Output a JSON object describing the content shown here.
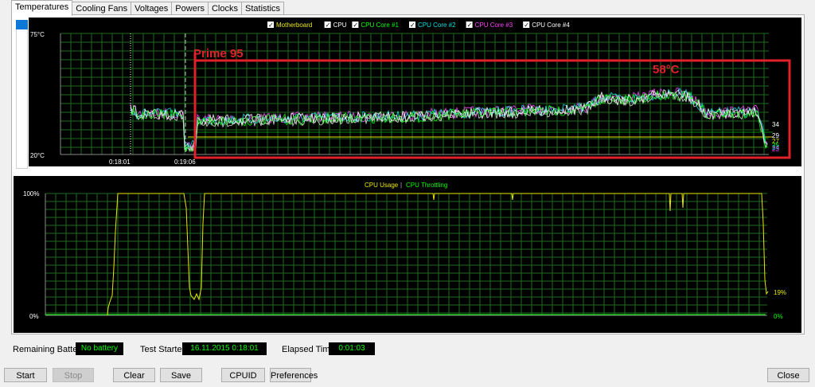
{
  "tabs": [
    {
      "label": "Temperatures",
      "active": true
    },
    {
      "label": "Cooling Fans"
    },
    {
      "label": "Voltages"
    },
    {
      "label": "Powers"
    },
    {
      "label": "Clocks"
    },
    {
      "label": "Statistics"
    }
  ],
  "temperature_chart": {
    "legend": [
      {
        "label": "Motherboard",
        "color": "#e8e800",
        "checked": true
      },
      {
        "label": "CPU",
        "color": "#ffffff",
        "checked": true
      },
      {
        "label": "CPU Core #1",
        "color": "#00ff00",
        "checked": true
      },
      {
        "label": "CPU Core #2",
        "color": "#00e0e0",
        "checked": true
      },
      {
        "label": "CPU Core #3",
        "color": "#ff40ff",
        "checked": true
      },
      {
        "label": "CPU Core #4",
        "color": "#ffffff",
        "checked": true
      }
    ],
    "y_top_label": "75°C",
    "y_bottom_label": "20°C",
    "time_labels": [
      "0:18:01",
      "0:19:06"
    ],
    "annotation_label": "Prime 95",
    "annotation_peak": "58°C",
    "annotation_color": "#e0202a",
    "end_values": [
      {
        "text": "34",
        "color": "#ffffff"
      },
      {
        "text": "29",
        "color": "#ffffff"
      },
      {
        "text": "27",
        "color": "#e8e800"
      },
      {
        "text": "25",
        "color": "#00ff00"
      },
      {
        "text": "24",
        "color": "#00e0e0"
      },
      {
        "text": "23",
        "color": "#ff40ff"
      }
    ]
  },
  "usage_chart": {
    "legend_usage": "CPU Usage",
    "legend_separator": "|",
    "legend_throttling": "CPU Throttling",
    "usage_color": "#e8e800",
    "throttling_color": "#00ff00",
    "y_top_label": "100%",
    "y_bottom_label": "0%",
    "end_usage": "19%",
    "end_throttling": "0%"
  },
  "status": {
    "battery_label": "Remaining Battery:",
    "battery_value": "No battery",
    "test_started_label": "Test Started:",
    "test_started_value": "16.11.2015 0:18:01",
    "elapsed_label": "Elapsed Time:",
    "elapsed_value": "0:01:03"
  },
  "buttons": {
    "start": "Start",
    "stop": "Stop",
    "clear": "Clear",
    "save": "Save",
    "cpuid": "CPUID",
    "preferences": "Preferences",
    "close": "Close"
  }
}
